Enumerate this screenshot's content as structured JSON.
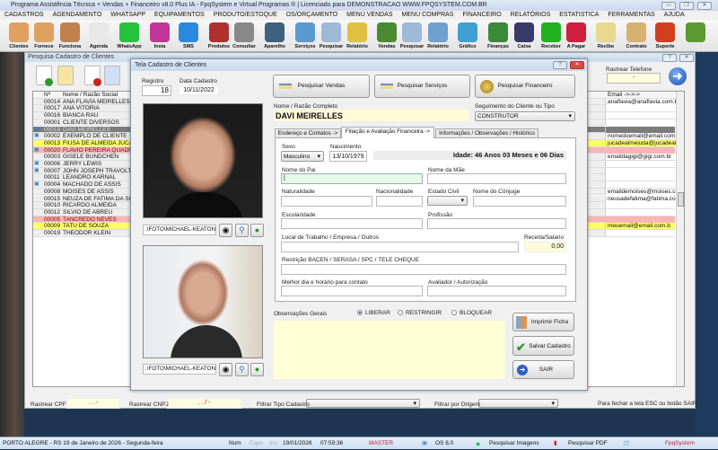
{
  "app": {
    "title": "Programa Assistência Técnica + Vendas + Financeiro v8.0 Plus IA - FpqSystem e Virtual Programas ® | Licenciado para  DEMONSTRACAO WWW.FPQSYSTEM.COM.BR"
  },
  "menu": [
    "CADASTROS",
    "AGENDAMENTO",
    "WHATSAPP",
    "EQUIPAMENTOS",
    "PRODUTO/ESTOQUE",
    "OS/ORÇAMENTO",
    "MENU VENDAS",
    "MENU COMPRAS",
    "FINANCEIRO",
    "RELATÓRIOS",
    "ESTATISTICA",
    "FERRAMENTAS",
    "AJUDA"
  ],
  "toolbar": [
    {
      "label": "Clientes",
      "icon": "clients-icon",
      "color": "#e0a060"
    },
    {
      "label": "Fornece",
      "icon": "supplier-icon",
      "color": "#e0a060"
    },
    {
      "label": "Funciona",
      "icon": "employee-icon",
      "color": "#c08050"
    },
    {
      "label": "Agenda",
      "icon": "calendar-icon",
      "color": "#e8e8e8"
    },
    {
      "label": "WhatsApp",
      "icon": "whatsapp-icon",
      "color": "#25c23a"
    },
    {
      "label": "Insta",
      "icon": "instagram-icon",
      "color": "#c2359a"
    },
    {
      "label": "SMS",
      "icon": "sms-icon",
      "color": "#2a8ae0"
    },
    {
      "label": "Produtos",
      "icon": "products-icon",
      "color": "#b03030"
    },
    {
      "label": "Consultar",
      "icon": "barcode-icon",
      "color": "#888888"
    },
    {
      "label": "Aparelho",
      "icon": "device-icon",
      "color": "#406080"
    },
    {
      "label": "Serviços",
      "icon": "services-icon",
      "color": "#5a9ad0"
    },
    {
      "label": "Pesquisar",
      "icon": "search-docs-icon",
      "color": "#a0b8d8"
    },
    {
      "label": "Relatório",
      "icon": "report-icon",
      "color": "#e0c040"
    },
    {
      "label": "Vendas",
      "icon": "cart-icon",
      "color": "#4a8a30"
    },
    {
      "label": "Pesquisar",
      "icon": "search-docs-icon",
      "color": "#a0b8d8"
    },
    {
      "label": "Relatório",
      "icon": "printer-icon",
      "color": "#70a0d0"
    },
    {
      "label": "Gráfico",
      "icon": "chart-icon",
      "color": "#40a0d0"
    },
    {
      "label": "Finanças",
      "icon": "finance-icon",
      "color": "#3a8a3a"
    },
    {
      "label": "Caixa",
      "icon": "cashbook-icon",
      "color": "#3a3a6a"
    },
    {
      "label": "Receber",
      "icon": "receive-icon",
      "color": "#20b020"
    },
    {
      "label": "A Pagar",
      "icon": "pay-icon",
      "color": "#d02040"
    },
    {
      "label": "Recibo",
      "icon": "receipt-icon",
      "color": "#e8d890"
    },
    {
      "label": "Contrato",
      "icon": "contract-icon",
      "color": "#d8b070"
    },
    {
      "label": "Suporte",
      "icon": "support-icon",
      "color": "#d04020"
    },
    {
      "label": "",
      "icon": "exit-door-icon",
      "color": "#5a9a30"
    }
  ],
  "search_window": {
    "title": "Pesquisa Cadastro de Clientes",
    "columns": {
      "num": "Nº",
      "name": "Nome / Razão Social",
      "email": "Email ->->->"
    },
    "rows": [
      {
        "num": "00014",
        "name": "ANA FLAVIA MEIRELLES",
        "email": "anaflavia@anaflavia.com.br",
        "highlight": "",
        "icon": false
      },
      {
        "num": "00017",
        "name": "ANA VITORIA",
        "email": "",
        "highlight": "",
        "icon": false
      },
      {
        "num": "00016",
        "name": "BIANCA RAU",
        "email": "",
        "highlight": "",
        "icon": false
      },
      {
        "num": "00001",
        "name": "CLIENTE DIVERSOS",
        "email": "",
        "highlight": "",
        "icon": false
      },
      {
        "num": "00018",
        "name": "DAVI MEIRELLES",
        "email": "",
        "highlight": "selected",
        "icon": true
      },
      {
        "num": "00002",
        "name": "EXEMPLO DE CLIENTE",
        "email": "nomedoemail@email.com.br",
        "highlight": "",
        "icon": true
      },
      {
        "num": "00013",
        "name": "FIUSA DE ALMEIDA JUCA C",
        "email": "jucadealmeiuda@jucadealmeda",
        "highlight": "yellow",
        "icon": false
      },
      {
        "num": "00020",
        "name": "FLAVIO PEREIRA QUADRA",
        "email": "",
        "highlight": "pink",
        "icon": true
      },
      {
        "num": "00003",
        "name": "GISELE BUNDCHEN",
        "email": "emaildagigi@gigi.com.br",
        "highlight": "",
        "icon": false
      },
      {
        "num": "00006",
        "name": "JERRY LEWIS",
        "email": "",
        "highlight": "",
        "icon": true
      },
      {
        "num": "00007",
        "name": "JOHN JOSEPH TRAVOLTA",
        "email": "",
        "highlight": "",
        "icon": true
      },
      {
        "num": "00011",
        "name": "LEANDRO KARNAL",
        "email": "",
        "highlight": "",
        "icon": false
      },
      {
        "num": "00004",
        "name": "MACHADO DE ASSIS",
        "email": "",
        "highlight": "",
        "icon": true
      },
      {
        "num": "00008",
        "name": "MOISES DE ASSIS",
        "email": "emaildemoises@moises.com.b",
        "highlight": "",
        "icon": false
      },
      {
        "num": "00015",
        "name": "NEUZA DE FATIMA DA SILV",
        "email": "neusadefatima@fatima.com.br",
        "highlight": "",
        "icon": false
      },
      {
        "num": "00010",
        "name": "RICARDO ALMEIDA",
        "email": "",
        "highlight": "",
        "icon": false
      },
      {
        "num": "00012",
        "name": "SILVIO DE ABREU",
        "email": "",
        "highlight": "",
        "icon": false
      },
      {
        "num": "00005",
        "name": "TANCREDO NEVES",
        "email": "",
        "highlight": "pink",
        "icon": false
      },
      {
        "num": "00009",
        "name": "TATU DE SOUZA",
        "email": "meuemail@email.com.b",
        "highlight": "yellow",
        "icon": false
      },
      {
        "num": "00019",
        "name": "THEODOR KLEIN",
        "email": "",
        "highlight": "",
        "icon": false
      }
    ],
    "rastrear_telefone_label": "Rastrear Telefone",
    "rastrear_telefone_value": "-",
    "rastrear_cpf_label": "Rastrear CPF",
    "rastrear_cpf_value": ". . -",
    "rastrear_cnpj_label": "Rastrear CNPJ",
    "rastrear_cnpj_value": ". . / -",
    "filtrar_tipo_label": "Filtrar Tipo Cadastro",
    "filtrar_origem_label": "Filtrar por Origem",
    "hint": "Para fechar a tela ESC ou botão SAIR"
  },
  "dialog": {
    "title": "Tela Cadastro de Clientes",
    "registro_label": "Registro",
    "registro": "18",
    "data_label": "Data Cadastro",
    "data": "10/11/2022",
    "photo1_path": ".\\FOTO\\MICHAEL-KEATONJ",
    "photo2_path": ".\\FOTO\\MICHAEL-KEATON2",
    "btn_vendas": "Pesquisar Vendas",
    "btn_servicos": "Pesquisar Serviços",
    "btn_financeiro": "Pesquisar  Financeiro",
    "nome_label": "Nome / Razão Completo",
    "nome": "DAVI MEIRELLES",
    "seg_label": "Seguimento do Cliente ou Tipo",
    "seg": "CONSTRUTOR",
    "tabs": [
      "Endereço e Contatos ->",
      "Filiação e Avaliação Financeira ->",
      "Informações / Observações / Histórico"
    ],
    "sexo_label": "Sexo",
    "sexo": "Masculino",
    "nasc_label": "Nascimento",
    "nasc": "13/10/1979",
    "idade": "Idade: 46 Anos 03 Meses e 06 Dias",
    "pai_label": "Nome do Pai",
    "mae_label": "Nome da Mãe",
    "natural_label": "Naturalidade",
    "nacional_label": "Nacionalidade",
    "civil_label": "Estado Civil",
    "conjuge_label": "Nome do Cônjuge",
    "escol_label": "Escolaridade",
    "prof_label": "Profissão",
    "local_label": "Local de Trabalho / Empresa / Outros",
    "receita_label": "Receita/Salario",
    "receita": "0,00",
    "restricao_label": "Restrição BACEN / SERASA / SPC / TELE CHEQUE",
    "melhor_label": "Melhor dia e horário para contato",
    "avaliador_label": "Avaliador / Autorização",
    "obs_label": "Observações Gerais",
    "radios": [
      "LIBERAR",
      "RESTRINGIR",
      "BLOQUEAR"
    ],
    "radio_selected": "LIBERAR",
    "btn_imprimir": "Imprimir Ficha",
    "btn_salvar": "Salvar Cadastro",
    "btn_sair": "SAIR"
  },
  "status": {
    "location": "PORTO ALEGRE - RS 19 de Janeiro de 2026 - Segunda-feira",
    "num": "Num",
    "caps": "Caps",
    "ins": "Ins",
    "date": "19/01/2026",
    "time": "07:59:36",
    "user": "MASTER",
    "os": "OS 8.0",
    "img": "Pesquisar Imagens",
    "pdf": "Pesquisar PDF",
    "brand": "FpqSystem"
  }
}
